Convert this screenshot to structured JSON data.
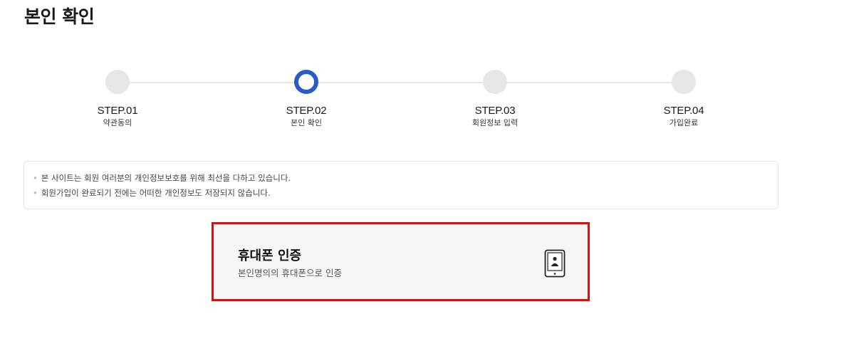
{
  "page": {
    "title": "본인 확인"
  },
  "stepper": {
    "current_step": 2,
    "steps": [
      {
        "label": "STEP.01",
        "sub": "약관동의"
      },
      {
        "label": "STEP.02",
        "sub": "본인 확인"
      },
      {
        "label": "STEP.03",
        "sub": "회원정보 입력"
      },
      {
        "label": "STEP.04",
        "sub": "가입완료"
      }
    ]
  },
  "notice": {
    "items": [
      "본 사이트는 회원 여러분의 개인정보보호를 위해 최선을 다하고 있습니다.",
      "회원가입이 완료되기 전에는 어떠한 개인정보도 저장되지 않습니다."
    ]
  },
  "auth_option": {
    "title": "휴대폰 인증",
    "description": "본인명의의 휴대폰으로 인증",
    "icon": "phone-person-icon"
  },
  "colors": {
    "active_step": "#2a5cc7",
    "inactive_step": "#e6e6e6",
    "highlight_border": "#e00d0d",
    "card_background": "#f6f6f6"
  }
}
